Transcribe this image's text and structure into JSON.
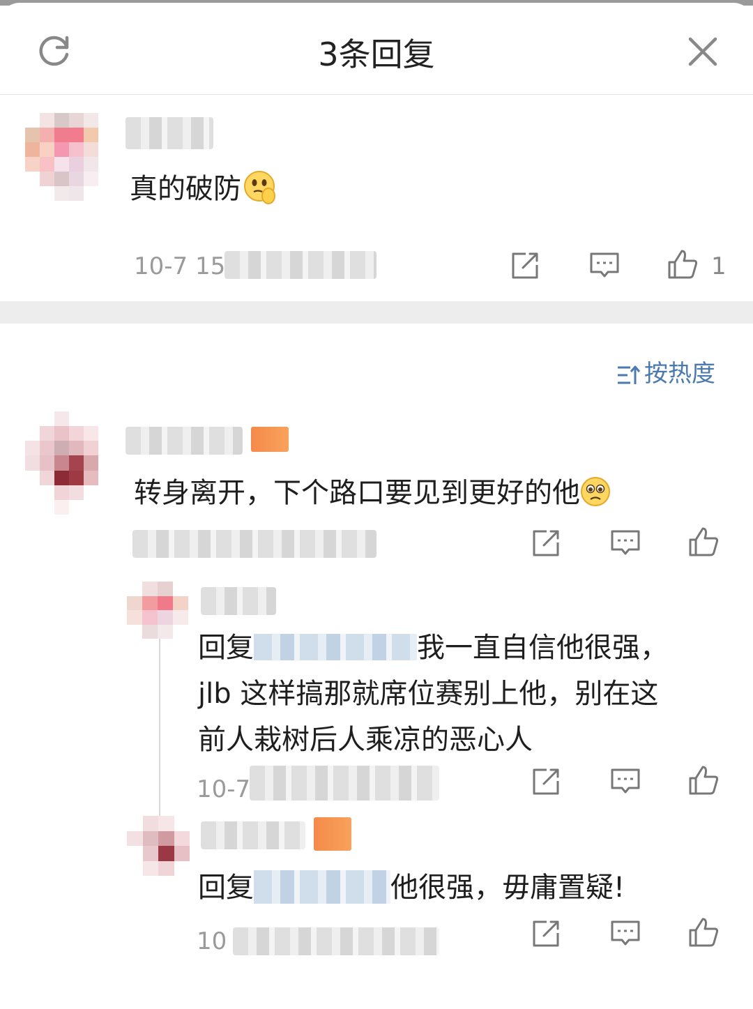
{
  "header": {
    "title": "3条回复",
    "refresh_icon": "refresh-icon",
    "close_icon": "close-icon"
  },
  "root_comment": {
    "text": "真的破防",
    "emoji": "thinking-face-emoji",
    "timestamp": "10-7 15",
    "like_count": "1"
  },
  "sort": {
    "label": "按热度",
    "icon": "sort-icon"
  },
  "comment": {
    "text": "转身离开，下个路口要见到更好的他",
    "emoji": "pleading-face-emoji"
  },
  "replies": [
    {
      "prefix": "回复",
      "text_line1": "我一直自信他很强，",
      "text_line2": "jlb 这样搞那就席位赛别上他，别在这",
      "text_line3": "前人栽树后人乘凉的恶心人",
      "timestamp": "10-7"
    },
    {
      "prefix": "回复",
      "text_line1": "他很强，毋庸置疑!",
      "timestamp": "10"
    }
  ],
  "colors": {
    "accent_blue": "#4a7ab0",
    "meta_gray": "#9a9a9a",
    "badge_orange": "#f58a4a"
  }
}
